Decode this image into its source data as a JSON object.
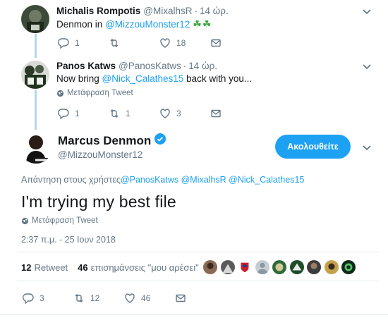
{
  "tweets": [
    {
      "name": "Michalis Rompotis",
      "handle": "@MixalhsR",
      "sep": "·",
      "time": "14 ώρ.",
      "text_prefix": "Denmon in ",
      "mention": "@MizzouMonster12",
      "emoji": "☘☘",
      "replies": "1",
      "retweets": "",
      "likes": "18"
    },
    {
      "name": "Panos Katws",
      "handle": "@PanosKatws",
      "sep": "·",
      "time": "14 ώρ.",
      "text_prefix": "Now bring ",
      "mention": "@Nick_Calathes15",
      "text_suffix": " back with you...",
      "translate": "Μετάφραση Tweet",
      "replies": "1",
      "retweets": "1",
      "likes": "3"
    }
  ],
  "main": {
    "name": "Marcus Denmon",
    "handle": "@MizzouMonster12",
    "follow_label": "Ακολουθείτε",
    "reply_to_label": "Απάντηση στους χρήστες",
    "reply_mentions": [
      "@PanosKatws",
      "@MixalhsR",
      "@Nick_Calathes15"
    ],
    "text": "I'm trying my best file",
    "translate": "Μετάφραση Tweet",
    "timestamp": "2:37 π.μ. - 25 Ιουν 2018",
    "retweet_count": "12",
    "retweet_label": "Retweet",
    "like_count": "46",
    "like_label": "επισημάνσεις \"μου αρέσει\"",
    "replies": "3",
    "retweets": "12",
    "likes": "46"
  },
  "liker_avatars": [
    "avatar-1",
    "avatar-2",
    "avatar-3",
    "avatar-4",
    "avatar-5",
    "avatar-6",
    "avatar-7",
    "avatar-8",
    "avatar-9"
  ],
  "colors": {
    "accent": "#1da1f2",
    "thread_line": "#b3d7ef",
    "muted": "#657786"
  }
}
